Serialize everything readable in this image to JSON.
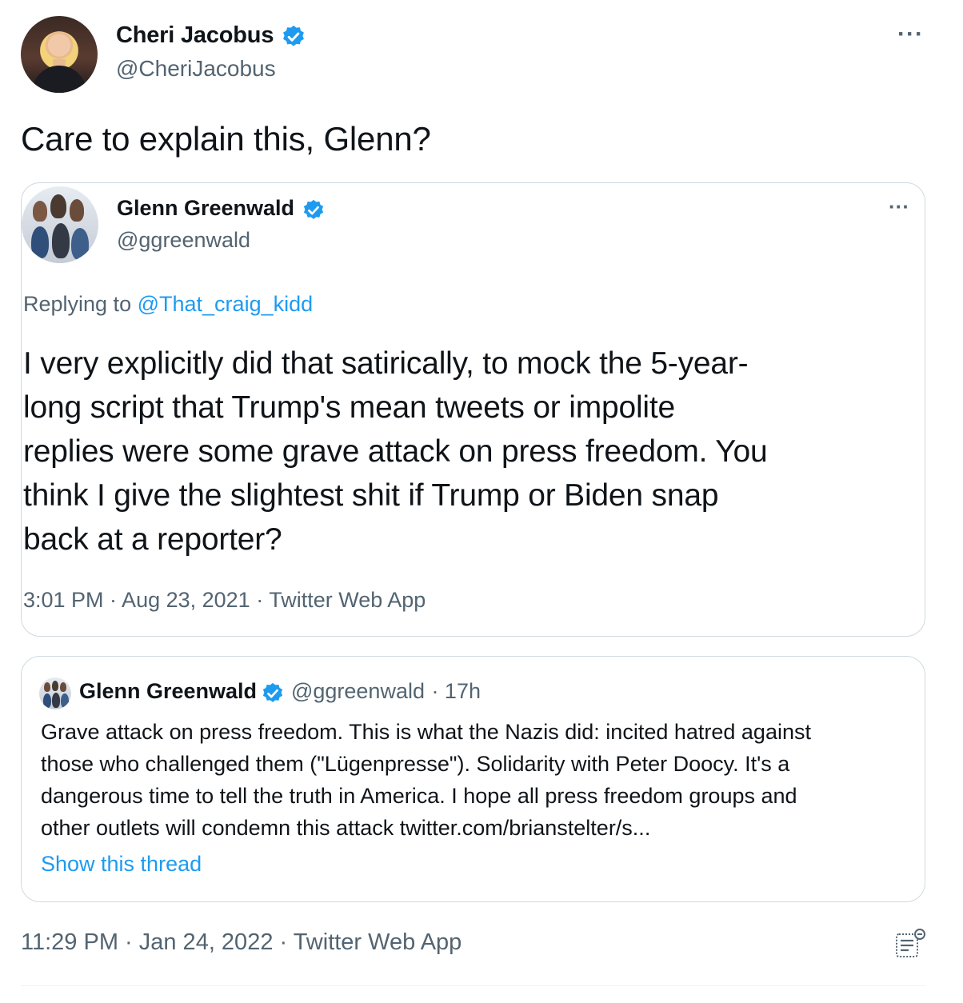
{
  "tweet": {
    "author": {
      "name": "Cheri Jacobus",
      "handle": "@CheriJacobus",
      "verified": true
    },
    "more_icon": "more-dots-icon",
    "text": "Care to explain this, Glenn?",
    "timestamp": "11:29 PM · Jan 24, 2022 · Twitter Web App",
    "analytics_icon": "analytics-icon"
  },
  "embedded_tweet": {
    "author": {
      "name": "Glenn Greenwald",
      "handle": "@ggreenwald",
      "verified": true
    },
    "replying_prefix": "Replying to",
    "replying_to": "@That_craig_kidd",
    "lines": [
      "I very explicitly did that satirically, to mock the 5-year-",
      "long script that Trump's mean tweets or impolite",
      "replies were some grave attack on press freedom. You",
      "think I give the slightest shit if Trump or Biden snap",
      "back at a reporter?"
    ],
    "timestamp": "3:01 PM · Aug 23, 2021 · Twitter Web App"
  },
  "quoted_tweet": {
    "author": {
      "name": "Glenn Greenwald",
      "handle": "@ggreenwald",
      "time": "· 17h",
      "verified": true
    },
    "lines": [
      "Grave attack on press freedom. This is what the Nazis did: incited hatred against",
      "those who challenged them (\"Lügenpresse\"). Solidarity with Peter Doocy. It's a",
      "dangerous time to tell the truth in America. I hope all press freedom groups and",
      "other outlets will condemn this attack twitter.com/brianstelter/s..."
    ],
    "show_thread": "Show this thread"
  },
  "colors": {
    "accent": "#1d9bf0",
    "secondary_text": "#536471",
    "border": "#cfd9de"
  }
}
